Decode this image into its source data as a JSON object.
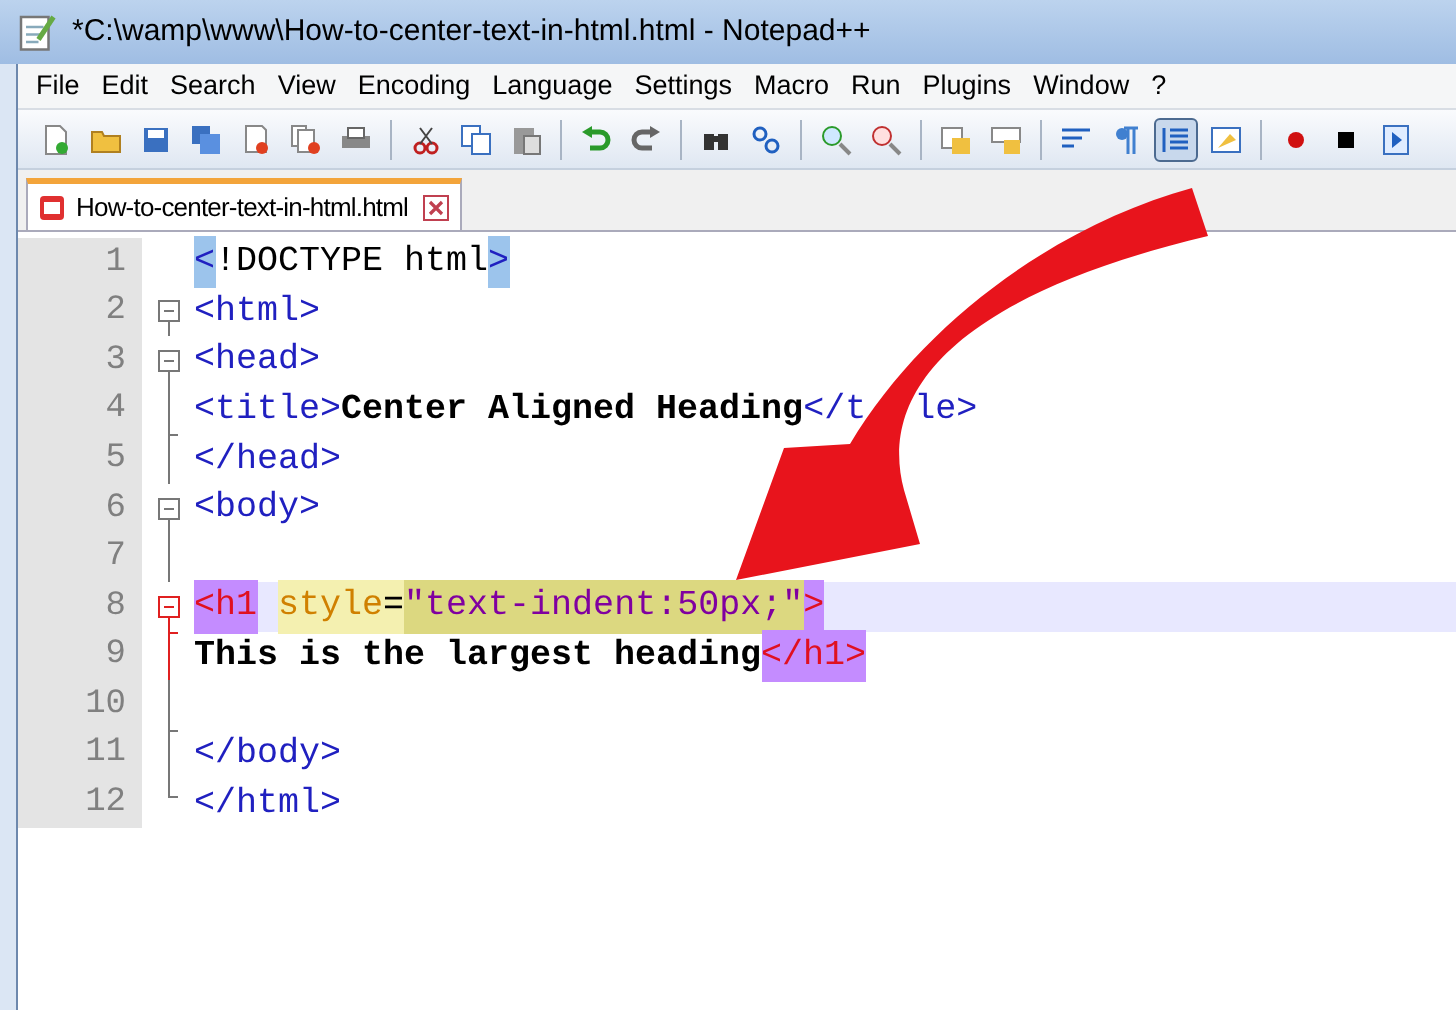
{
  "window": {
    "title": "*C:\\wamp\\www\\How-to-center-text-in-html.html - Notepad++"
  },
  "menu": [
    "File",
    "Edit",
    "Search",
    "View",
    "Encoding",
    "Language",
    "Settings",
    "Macro",
    "Run",
    "Plugins",
    "Window",
    "?"
  ],
  "toolbar": [
    {
      "selected": false
    },
    {
      "selected": false
    },
    {
      "selected": false
    },
    {
      "selected": false
    },
    {
      "selected": false
    },
    {
      "selected": false
    },
    {
      "selected": false
    },
    {
      "selected": false
    },
    {
      "selected": false
    },
    {
      "selected": false
    },
    {
      "selected": false
    },
    {
      "selected": false
    },
    {
      "selected": false
    },
    {
      "selected": false
    },
    {
      "selected": false
    },
    {
      "selected": false
    },
    {
      "selected": false
    },
    {
      "selected": false
    },
    {
      "selected": false
    },
    {
      "selected": false
    },
    {
      "selected": true
    },
    {
      "selected": false
    },
    {
      "selected": false
    },
    {
      "selected": false
    },
    {
      "selected": false
    }
  ],
  "tabs": [
    {
      "label": "How-to-center-text-in-html.html",
      "selected": true,
      "modified": true
    }
  ],
  "editor": {
    "lines": [
      {
        "number": "1",
        "current": false,
        "tokens": [
          {
            "kind": "tag",
            "text": "<",
            "brace_match": true
          },
          {
            "kind": "doctype",
            "text": "!DOCTYPE html"
          },
          {
            "kind": "tag",
            "text": ">",
            "brace_match": true
          }
        ]
      },
      {
        "number": "2",
        "fold": {
          "kind": "open",
          "active": false
        },
        "current": false,
        "tokens": [
          {
            "kind": "tag",
            "text": "<html>"
          }
        ]
      },
      {
        "number": "3",
        "fold": {
          "kind": "open",
          "active": false
        },
        "current": false,
        "tokens": [
          {
            "kind": "tag",
            "text": "<head>"
          }
        ]
      },
      {
        "number": "4",
        "fold": {
          "kind": "line",
          "active": false
        },
        "current": false,
        "tokens": [
          {
            "kind": "tag",
            "text": "<title>"
          },
          {
            "kind": "text",
            "text": "Center Aligned Heading"
          },
          {
            "kind": "tag",
            "text": "</t"
          },
          {
            "kind": "tag",
            "text": "le>"
          }
        ]
      },
      {
        "number": "5",
        "fold": {
          "kind": "end",
          "active": false
        },
        "current": false,
        "tokens": [
          {
            "kind": "tag",
            "text": "</head>"
          }
        ]
      },
      {
        "number": "6",
        "fold": {
          "kind": "open",
          "active": false
        },
        "current": false,
        "tokens": [
          {
            "kind": "tag",
            "text": "<body>"
          }
        ]
      },
      {
        "number": "7",
        "fold": {
          "kind": "line",
          "active": false
        },
        "current": false
      },
      {
        "number": "8",
        "fold": {
          "kind": "open",
          "active": true
        },
        "current": true,
        "tokens": [
          {
            "kind": "h1",
            "text": "<h1",
            "tag_match": true
          },
          {
            "kind": "attr",
            "text": "style",
            "smart_highlight": true
          },
          {
            "kind": "punct",
            "text": "=",
            "smart_highlight": true
          },
          {
            "kind": "string",
            "text": "\"text-indent:50px;\"",
            "smart_highlight": true,
            "found_match": true
          },
          {
            "kind": "h1",
            "text": ">",
            "tag_match": true
          }
        ]
      },
      {
        "number": "9",
        "fold": {
          "kind": "end",
          "active": true
        },
        "current": false,
        "tokens": [
          {
            "kind": "text",
            "text": "This is the largest heading"
          },
          {
            "kind": "h1",
            "text": "</h1>",
            "tag_match": true
          }
        ]
      },
      {
        "number": "10",
        "fold": {
          "kind": "line",
          "active": false
        },
        "current": false
      },
      {
        "number": "11",
        "fold": {
          "kind": "end",
          "active": false
        },
        "current": false,
        "tokens": [
          {
            "kind": "tag",
            "text": "</body>"
          }
        ]
      },
      {
        "number": "12",
        "fold": {
          "kind": "last",
          "active": false
        },
        "current": false,
        "tokens": [
          {
            "kind": "tag",
            "text": "</html>"
          }
        ]
      }
    ]
  }
}
